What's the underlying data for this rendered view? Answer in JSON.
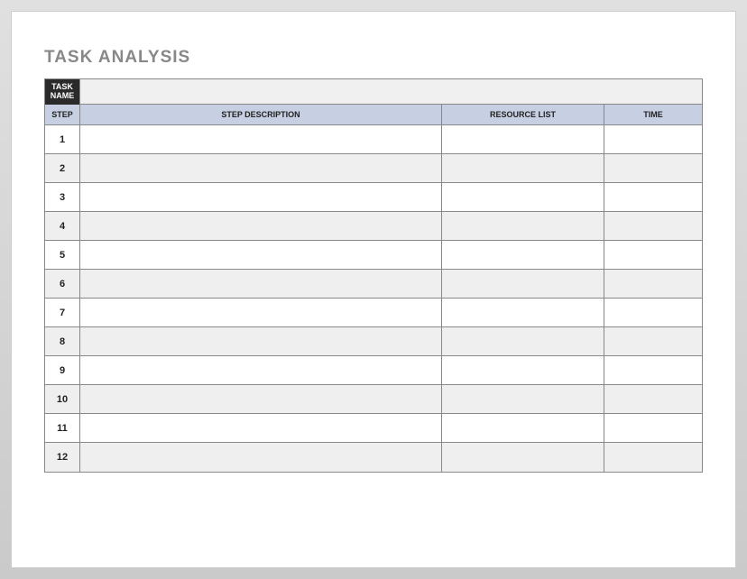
{
  "title": "TASK ANALYSIS",
  "task_name": {
    "label": "TASK NAME",
    "value": ""
  },
  "columns": {
    "step": "STEP",
    "description": "STEP DESCRIPTION",
    "resource": "RESOURCE LIST",
    "time": "TIME"
  },
  "rows": [
    {
      "step": "1",
      "description": "",
      "resource": "",
      "time": ""
    },
    {
      "step": "2",
      "description": "",
      "resource": "",
      "time": ""
    },
    {
      "step": "3",
      "description": "",
      "resource": "",
      "time": ""
    },
    {
      "step": "4",
      "description": "",
      "resource": "",
      "time": ""
    },
    {
      "step": "5",
      "description": "",
      "resource": "",
      "time": ""
    },
    {
      "step": "6",
      "description": "",
      "resource": "",
      "time": ""
    },
    {
      "step": "7",
      "description": "",
      "resource": "",
      "time": ""
    },
    {
      "step": "8",
      "description": "",
      "resource": "",
      "time": ""
    },
    {
      "step": "9",
      "description": "",
      "resource": "",
      "time": ""
    },
    {
      "step": "10",
      "description": "",
      "resource": "",
      "time": ""
    },
    {
      "step": "11",
      "description": "",
      "resource": "",
      "time": ""
    },
    {
      "step": "12",
      "description": "",
      "resource": "",
      "time": ""
    }
  ]
}
